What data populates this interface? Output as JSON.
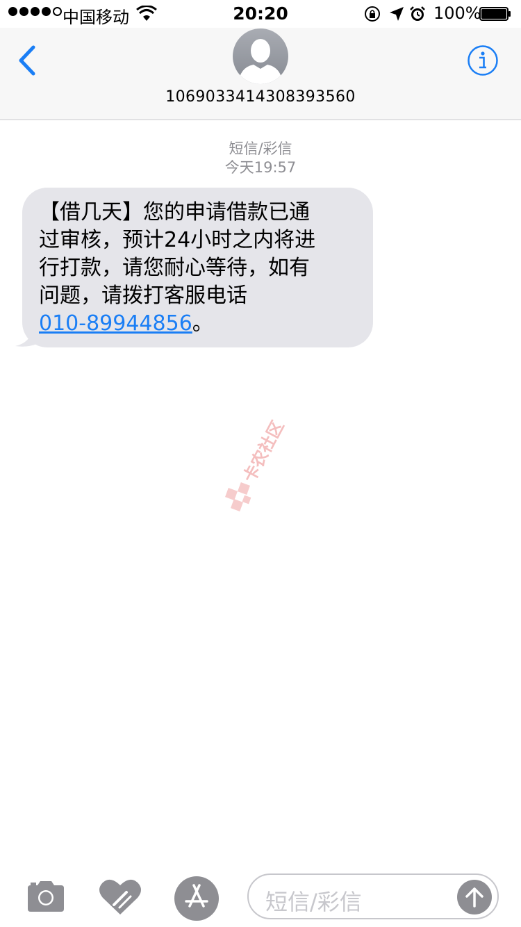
{
  "status_bar": {
    "carrier": "中国移动",
    "time": "20:20",
    "battery_percent": "100%",
    "battery_level": 1.0
  },
  "header": {
    "contact_number": "1069033414308393560"
  },
  "conversation": {
    "message_type": "短信/彩信",
    "timestamp": "今天19:57",
    "message": {
      "lines": [
        "【借几天】您的申请借款已通",
        "过审核，预计24小时之内将进",
        "行打款，请您耐心等待，如有",
        "问题，请拨打客服电话"
      ],
      "phone_link": "010-89944856",
      "trailing": "。"
    }
  },
  "watermark": {
    "text": "卡农社区"
  },
  "input": {
    "placeholder": "短信/彩信"
  },
  "colors": {
    "accent": "#1a7ef5",
    "bubble": "#e5e5ea",
    "toolbar_icon": "#8e8e93",
    "meta_text": "#8e8e93",
    "watermark": "#f0a3a3"
  },
  "icons": {
    "back": "chevron-left-icon",
    "info": "info-icon",
    "camera": "camera-icon",
    "digital_touch": "heart-icon",
    "app_store": "app-store-icon",
    "send": "arrow-up-icon"
  }
}
